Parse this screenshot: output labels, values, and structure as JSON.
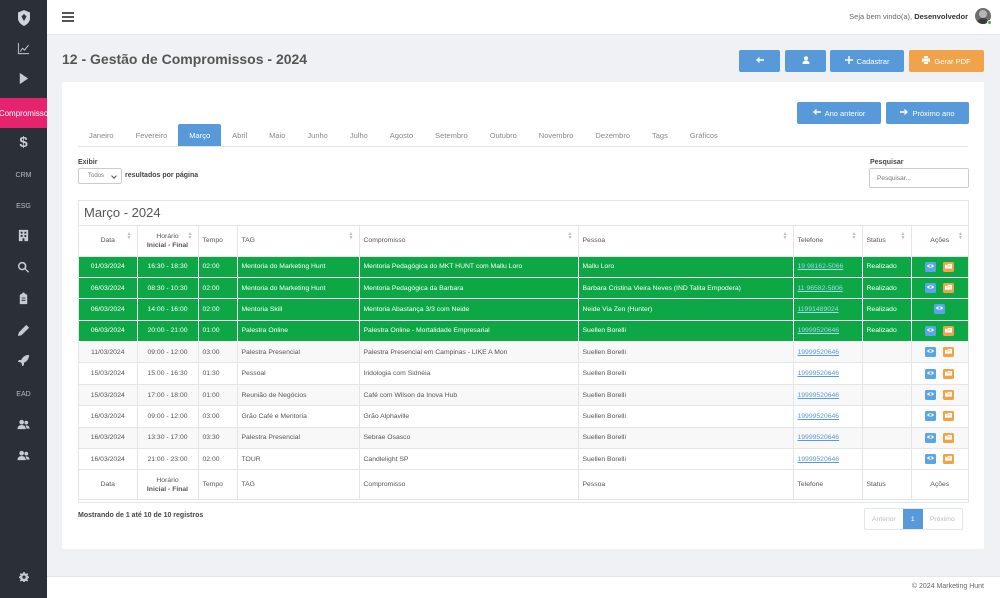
{
  "sidebar": {
    "items": [
      {
        "name": "chart-icon",
        "label": ""
      },
      {
        "name": "play-icon",
        "label": ""
      },
      {
        "name": "compromissos",
        "label": "Compromisso"
      },
      {
        "name": "dollar-icon",
        "label": ""
      },
      {
        "name": "crm",
        "label": "CRM"
      },
      {
        "name": "esg",
        "label": "ESG"
      },
      {
        "name": "building-icon",
        "label": ""
      },
      {
        "name": "search-icon",
        "label": ""
      },
      {
        "name": "clipboard-icon",
        "label": ""
      },
      {
        "name": "pencil-icon",
        "label": ""
      },
      {
        "name": "rocket-icon",
        "label": ""
      },
      {
        "name": "ead",
        "label": "EAD"
      },
      {
        "name": "users-icon",
        "label": ""
      },
      {
        "name": "users2-icon",
        "label": ""
      },
      {
        "name": "gear-icon",
        "label": ""
      }
    ]
  },
  "topbar": {
    "welcome": "Seja bem vindo(a),",
    "user": "Desenvolvedor"
  },
  "page": {
    "title": "12 - Gestão de Compromissos - 2024"
  },
  "actions": {
    "cadastrar": "Cadastrar",
    "gerar_pdf": "Gerar PDF",
    "ano_anterior": "Ano anterior",
    "proximo_ano": "Próximo ano"
  },
  "tabs": [
    "Janeiro",
    "Fevereiro",
    "Março",
    "Abril",
    "Maio",
    "Junho",
    "Julho",
    "Agosto",
    "Setembro",
    "Outubro",
    "Novembro",
    "Dezembro",
    "Tags",
    "Gráficos"
  ],
  "active_tab": "Março",
  "filters": {
    "exibir": "Exibir",
    "select_value": "Todos",
    "per_page": "resultados por página",
    "pesquisar": "Pesquisar",
    "search_placeholder": "Pesquisar..."
  },
  "table": {
    "title": "Março - 2024",
    "headers": {
      "data": "Data",
      "horario": "Horário",
      "horario_sub": "Inicial - Final",
      "tempo": "Tempo",
      "tag": "TAG",
      "compromisso": "Compromisso",
      "pessoa": "Pessoa",
      "telefone": "Telefone",
      "status": "Status",
      "acoes": "Ações"
    },
    "rows": [
      {
        "data": "01/03/2024",
        "horario": "16:30 - 18:30",
        "tempo": "02:00",
        "tag": "Mentoria do Marketing Hunt",
        "compromisso": "Mentoria Pedagógica do MKT HUNT com Mallu Loro",
        "pessoa": "Mallu Loro",
        "telefone": "19 98162-5066",
        "status": "Realizado",
        "done": true,
        "edit": true
      },
      {
        "data": "06/03/2024",
        "horario": "08:30 - 10:30",
        "tempo": "02:00",
        "tag": "Mentoria do Marketing Hunt",
        "compromisso": "Mentoria Pedagógica da Barbara",
        "pessoa": "Barbara Cristina Vieira Neves (IND Talita Empodera)",
        "telefone": "11 96582-5806",
        "status": "Realizado",
        "done": true,
        "edit": true
      },
      {
        "data": "06/03/2024",
        "horario": "14:00 - 16:00",
        "tempo": "02:00",
        "tag": "Mentoria Skill",
        "compromisso": "Mentoria Abastança 3/3 com Neide",
        "pessoa": "Neide Via Zen (Hunter)",
        "telefone": "11991489024",
        "status": "Realizado",
        "done": true,
        "edit": false
      },
      {
        "data": "06/03/2024",
        "horario": "20:00 - 21:00",
        "tempo": "01:00",
        "tag": "Palestra Online",
        "compromisso": "Palestra Online - Mortalidade Empresarial",
        "pessoa": "Suellen Borelli",
        "telefone": "19999520646",
        "status": "Realizado",
        "done": true,
        "edit": true
      },
      {
        "data": "11/03/2024",
        "horario": "09:00 - 12:00",
        "tempo": "03:00",
        "tag": "Palestra Presencial",
        "compromisso": "Palestra Presencial em Campinas - LIKE A Mon",
        "pessoa": "Suellen Borelli",
        "telefone": "19999520646",
        "status": "",
        "done": false,
        "edit": true
      },
      {
        "data": "15/03/2024",
        "horario": "15:00 - 16:30",
        "tempo": "01:30",
        "tag": "Pessoal",
        "compromisso": "Iridologia com Sidnéia",
        "pessoa": "Suellen Borelli",
        "telefone": "19999520646",
        "status": "",
        "done": false,
        "edit": true
      },
      {
        "data": "15/03/2024",
        "horario": "17:00 - 18:00",
        "tempo": "01:00",
        "tag": "Reunião de Negócios",
        "compromisso": "Café com Wilson da Inova Hub",
        "pessoa": "Suellen Borelli",
        "telefone": "19999520646",
        "status": "",
        "done": false,
        "edit": true
      },
      {
        "data": "16/03/2024",
        "horario": "09:00 - 12:00",
        "tempo": "03:00",
        "tag": "Grão Café e Mentoria",
        "compromisso": "Grão Alphaville",
        "pessoa": "Suellen Borelli",
        "telefone": "19999520646",
        "status": "",
        "done": false,
        "edit": true
      },
      {
        "data": "16/03/2024",
        "horario": "13:30 - 17:00",
        "tempo": "03:30",
        "tag": "Palestra Presencial",
        "compromisso": "Sebrae Osasco",
        "pessoa": "Suellen Borelli",
        "telefone": "19999520646",
        "status": "",
        "done": false,
        "edit": true
      },
      {
        "data": "16/03/2024",
        "horario": "21:00 - 23:00",
        "tempo": "02:00",
        "tag": "TOUR",
        "compromisso": "Candlelight SP",
        "pessoa": "Suellen Borelli",
        "telefone": "19999520646",
        "status": "",
        "done": false,
        "edit": true
      }
    ]
  },
  "summary": "Mostrando de 1 até 10 de 10 registros",
  "pagination": {
    "prev": "Anterior",
    "current": "1",
    "next": "Próximo"
  },
  "footer": "© 2024 Marketing Hunt",
  "colors": {
    "primary": "#5899da",
    "accent": "#e6246e",
    "done": "#0ea746",
    "warning": "#f0a348",
    "sidebar": "#2a3035"
  }
}
